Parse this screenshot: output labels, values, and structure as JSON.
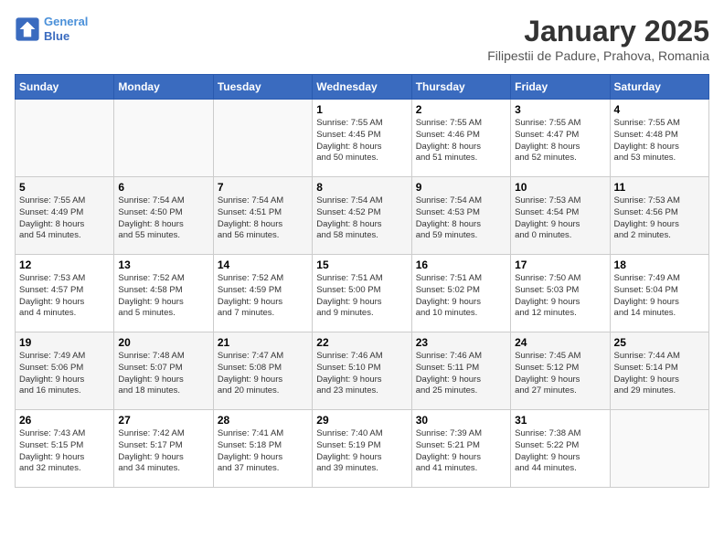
{
  "logo": {
    "line1": "General",
    "line2": "Blue"
  },
  "title": "January 2025",
  "subtitle": "Filipestii de Padure, Prahova, Romania",
  "headers": [
    "Sunday",
    "Monday",
    "Tuesday",
    "Wednesday",
    "Thursday",
    "Friday",
    "Saturday"
  ],
  "weeks": [
    [
      {
        "day": "",
        "info": ""
      },
      {
        "day": "",
        "info": ""
      },
      {
        "day": "",
        "info": ""
      },
      {
        "day": "1",
        "info": "Sunrise: 7:55 AM\nSunset: 4:45 PM\nDaylight: 8 hours\nand 50 minutes."
      },
      {
        "day": "2",
        "info": "Sunrise: 7:55 AM\nSunset: 4:46 PM\nDaylight: 8 hours\nand 51 minutes."
      },
      {
        "day": "3",
        "info": "Sunrise: 7:55 AM\nSunset: 4:47 PM\nDaylight: 8 hours\nand 52 minutes."
      },
      {
        "day": "4",
        "info": "Sunrise: 7:55 AM\nSunset: 4:48 PM\nDaylight: 8 hours\nand 53 minutes."
      }
    ],
    [
      {
        "day": "5",
        "info": "Sunrise: 7:55 AM\nSunset: 4:49 PM\nDaylight: 8 hours\nand 54 minutes."
      },
      {
        "day": "6",
        "info": "Sunrise: 7:54 AM\nSunset: 4:50 PM\nDaylight: 8 hours\nand 55 minutes."
      },
      {
        "day": "7",
        "info": "Sunrise: 7:54 AM\nSunset: 4:51 PM\nDaylight: 8 hours\nand 56 minutes."
      },
      {
        "day": "8",
        "info": "Sunrise: 7:54 AM\nSunset: 4:52 PM\nDaylight: 8 hours\nand 58 minutes."
      },
      {
        "day": "9",
        "info": "Sunrise: 7:54 AM\nSunset: 4:53 PM\nDaylight: 8 hours\nand 59 minutes."
      },
      {
        "day": "10",
        "info": "Sunrise: 7:53 AM\nSunset: 4:54 PM\nDaylight: 9 hours\nand 0 minutes."
      },
      {
        "day": "11",
        "info": "Sunrise: 7:53 AM\nSunset: 4:56 PM\nDaylight: 9 hours\nand 2 minutes."
      }
    ],
    [
      {
        "day": "12",
        "info": "Sunrise: 7:53 AM\nSunset: 4:57 PM\nDaylight: 9 hours\nand 4 minutes."
      },
      {
        "day": "13",
        "info": "Sunrise: 7:52 AM\nSunset: 4:58 PM\nDaylight: 9 hours\nand 5 minutes."
      },
      {
        "day": "14",
        "info": "Sunrise: 7:52 AM\nSunset: 4:59 PM\nDaylight: 9 hours\nand 7 minutes."
      },
      {
        "day": "15",
        "info": "Sunrise: 7:51 AM\nSunset: 5:00 PM\nDaylight: 9 hours\nand 9 minutes."
      },
      {
        "day": "16",
        "info": "Sunrise: 7:51 AM\nSunset: 5:02 PM\nDaylight: 9 hours\nand 10 minutes."
      },
      {
        "day": "17",
        "info": "Sunrise: 7:50 AM\nSunset: 5:03 PM\nDaylight: 9 hours\nand 12 minutes."
      },
      {
        "day": "18",
        "info": "Sunrise: 7:49 AM\nSunset: 5:04 PM\nDaylight: 9 hours\nand 14 minutes."
      }
    ],
    [
      {
        "day": "19",
        "info": "Sunrise: 7:49 AM\nSunset: 5:06 PM\nDaylight: 9 hours\nand 16 minutes."
      },
      {
        "day": "20",
        "info": "Sunrise: 7:48 AM\nSunset: 5:07 PM\nDaylight: 9 hours\nand 18 minutes."
      },
      {
        "day": "21",
        "info": "Sunrise: 7:47 AM\nSunset: 5:08 PM\nDaylight: 9 hours\nand 20 minutes."
      },
      {
        "day": "22",
        "info": "Sunrise: 7:46 AM\nSunset: 5:10 PM\nDaylight: 9 hours\nand 23 minutes."
      },
      {
        "day": "23",
        "info": "Sunrise: 7:46 AM\nSunset: 5:11 PM\nDaylight: 9 hours\nand 25 minutes."
      },
      {
        "day": "24",
        "info": "Sunrise: 7:45 AM\nSunset: 5:12 PM\nDaylight: 9 hours\nand 27 minutes."
      },
      {
        "day": "25",
        "info": "Sunrise: 7:44 AM\nSunset: 5:14 PM\nDaylight: 9 hours\nand 29 minutes."
      }
    ],
    [
      {
        "day": "26",
        "info": "Sunrise: 7:43 AM\nSunset: 5:15 PM\nDaylight: 9 hours\nand 32 minutes."
      },
      {
        "day": "27",
        "info": "Sunrise: 7:42 AM\nSunset: 5:17 PM\nDaylight: 9 hours\nand 34 minutes."
      },
      {
        "day": "28",
        "info": "Sunrise: 7:41 AM\nSunset: 5:18 PM\nDaylight: 9 hours\nand 37 minutes."
      },
      {
        "day": "29",
        "info": "Sunrise: 7:40 AM\nSunset: 5:19 PM\nDaylight: 9 hours\nand 39 minutes."
      },
      {
        "day": "30",
        "info": "Sunrise: 7:39 AM\nSunset: 5:21 PM\nDaylight: 9 hours\nand 41 minutes."
      },
      {
        "day": "31",
        "info": "Sunrise: 7:38 AM\nSunset: 5:22 PM\nDaylight: 9 hours\nand 44 minutes."
      },
      {
        "day": "",
        "info": ""
      }
    ]
  ]
}
